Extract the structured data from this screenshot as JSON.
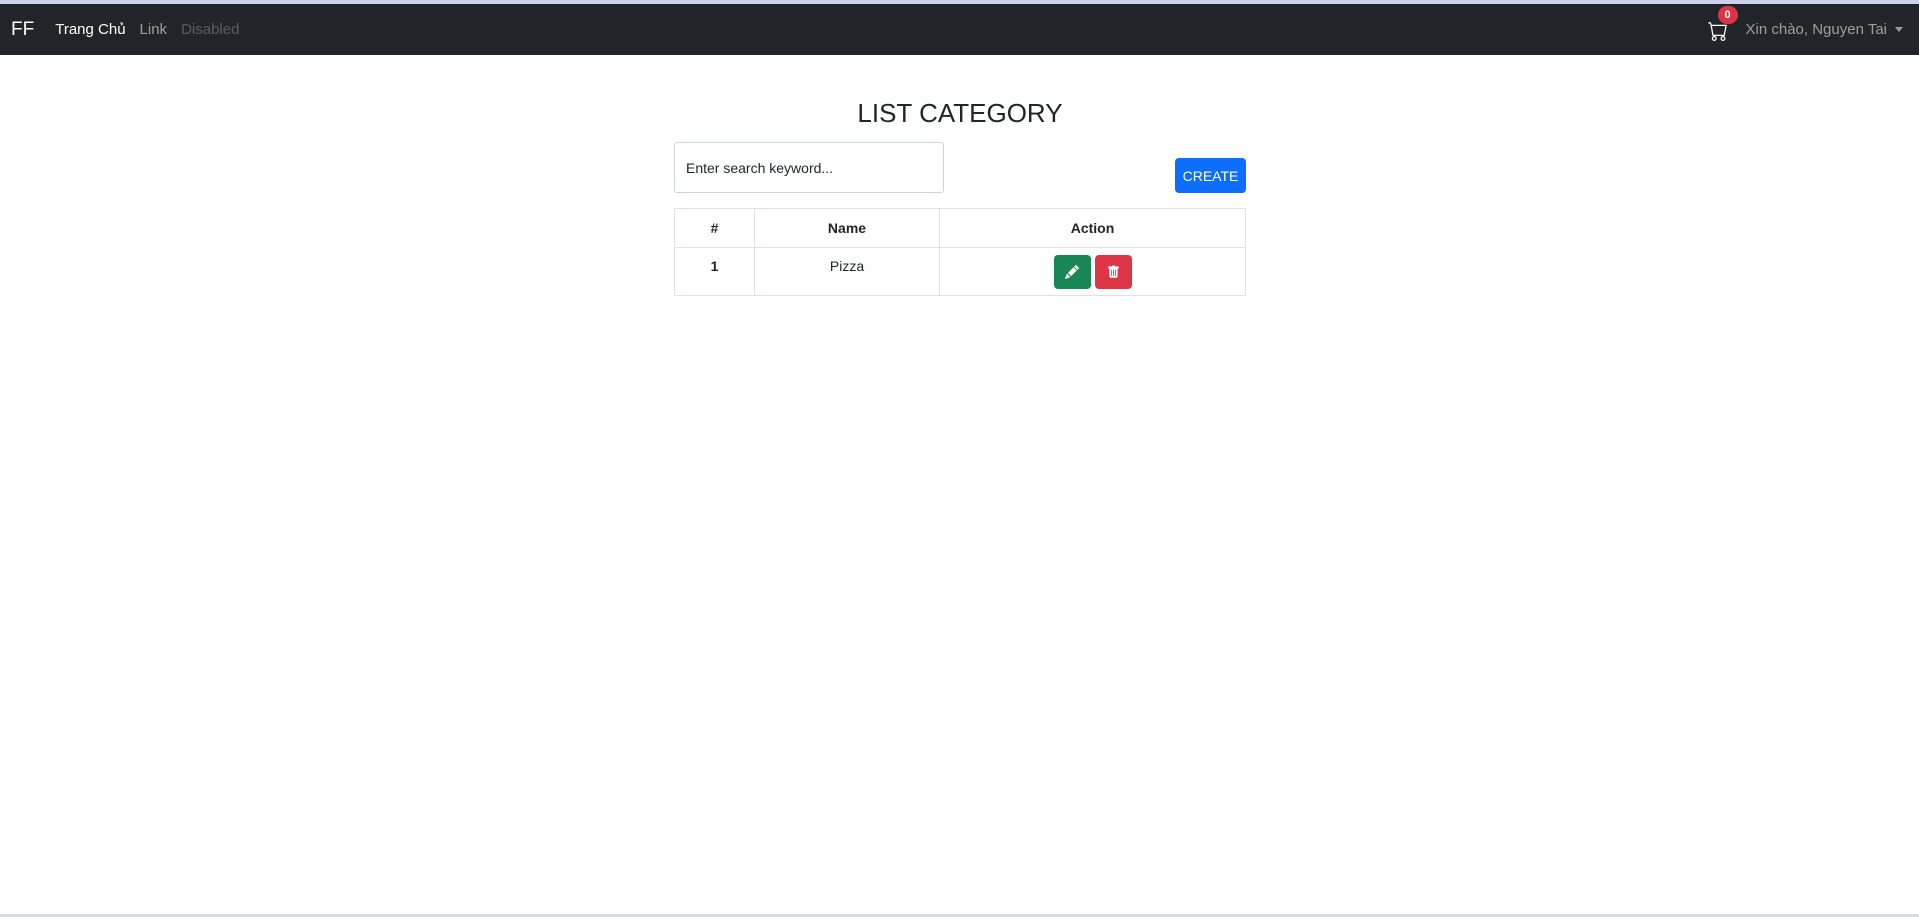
{
  "navbar": {
    "brand": "FF",
    "links": [
      {
        "label": "Trang Chủ"
      },
      {
        "label": "Link"
      },
      {
        "label": "Disabled"
      }
    ],
    "cart_count": "0",
    "user_greeting": "Xin chào, Nguyen Tai"
  },
  "main": {
    "title": "LIST CATEGORY",
    "search": {
      "placeholder": "Enter search keyword...",
      "value": ""
    },
    "create_label": "CREATE",
    "table": {
      "headers": [
        "#",
        "Name",
        "Action"
      ],
      "rows": [
        {
          "num": "1",
          "name": "Pizza"
        }
      ]
    }
  },
  "colors": {
    "navbar_bg": "#212529",
    "primary": "#0d6efd",
    "success": "#198754",
    "danger": "#dc3545"
  },
  "icons": {
    "cart": "cart-icon",
    "edit": "pencil-icon",
    "delete": "trash-icon"
  }
}
